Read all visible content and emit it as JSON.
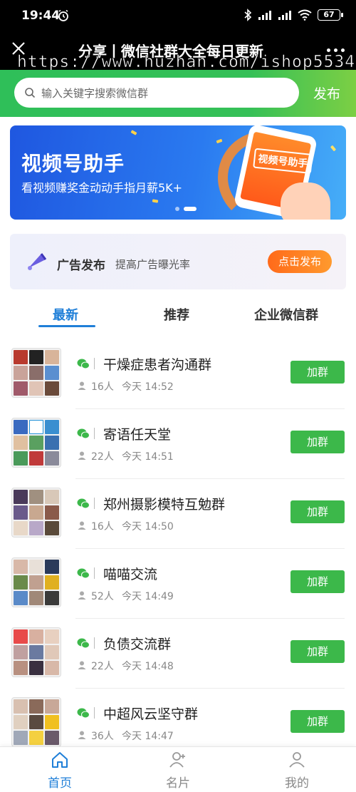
{
  "status": {
    "time": "19:44",
    "battery": "67"
  },
  "titlebar": {
    "title": "分享丨微信社群大全每日更新",
    "subtitle": "https://www.huzhan.com/ishop5534"
  },
  "search": {
    "placeholder": "输入关键字搜索微信群",
    "publish_label": "发布"
  },
  "banner": {
    "title": "视频号助手",
    "subtitle": "看视频赚奖金动动手指月薪5K+",
    "phone_badge": "视频号\n助手"
  },
  "ad": {
    "title": "广告发布",
    "desc": "提高广告曝光率",
    "button": "点击发布"
  },
  "tabs": [
    {
      "label": "最新",
      "active": true
    },
    {
      "label": "推荐",
      "active": false
    },
    {
      "label": "企业微信群",
      "active": false
    }
  ],
  "groups": [
    {
      "name": "干燥症患者沟通群",
      "count": "16人",
      "time": "今天 14:52",
      "join": "加群"
    },
    {
      "name": "寄语任天堂",
      "count": "22人",
      "time": "今天 14:51",
      "join": "加群"
    },
    {
      "name": "郑州摄影模特互勉群",
      "count": "16人",
      "time": "今天 14:50",
      "join": "加群"
    },
    {
      "name": "喵喵交流",
      "count": "52人",
      "time": "今天 14:49",
      "join": "加群"
    },
    {
      "name": "负债交流群",
      "count": "22人",
      "time": "今天 14:48",
      "join": "加群"
    },
    {
      "name": "中超风云坚守群",
      "count": "36人",
      "time": "今天 14:47",
      "join": "加群"
    }
  ],
  "bottomnav": [
    {
      "label": "首页",
      "icon": "home-icon",
      "active": true
    },
    {
      "label": "名片",
      "icon": "add-contact-icon",
      "active": false
    },
    {
      "label": "我的",
      "icon": "profile-icon",
      "active": false
    }
  ],
  "colors": {
    "accent": "#1f7fd8",
    "green": "#3cb84a",
    "orange": "#ff7a22"
  }
}
